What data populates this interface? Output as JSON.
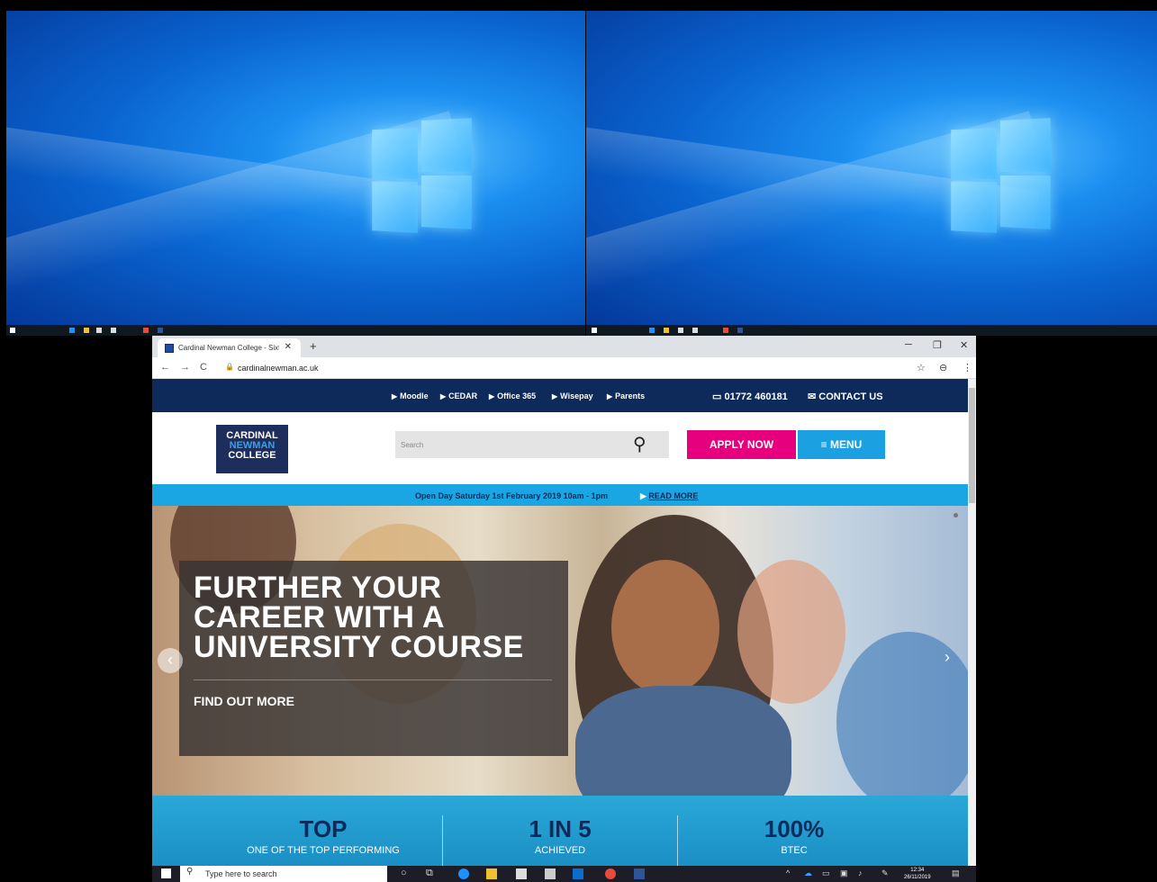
{
  "browser": {
    "tab_title": "Cardinal Newman College - Sixth",
    "url": "cardinalnewman.ac.uk",
    "new_tab": "+",
    "close_tab": "✕"
  },
  "site": {
    "quick_links": [
      "Moodle",
      "CEDAR",
      "Office 365",
      "Wisepay",
      "Parents"
    ],
    "phone": "01772 460181",
    "contact": "CONTACT US",
    "logo": [
      "CARDINAL",
      "NEWMAN",
      "COLLEGE"
    ],
    "search_placeholder": "Search",
    "apply_label": "APPLY NOW",
    "menu_label": "MENU",
    "open_day_text": "Open Day Saturday 1st February 2019 10am - 1pm",
    "read_more": "READ MORE",
    "hero": {
      "headline_lines": [
        "FURTHER YOUR",
        "CAREER WITH A",
        "UNIVERSITY COURSE"
      ],
      "cta": "FIND OUT MORE"
    },
    "stats": [
      {
        "big": "TOP",
        "small": "ONE OF THE TOP PERFORMING"
      },
      {
        "big": "1 IN 5",
        "small": "ACHIEVED"
      },
      {
        "big": "100%",
        "small": "BTEC"
      }
    ]
  },
  "taskbar": {
    "search_placeholder": "Type here to search",
    "time": "12:34",
    "date": "26/11/2019"
  },
  "colors": {
    "navy": "#0d2a5a",
    "pink": "#e6007e",
    "blue": "#1ba1e2"
  }
}
